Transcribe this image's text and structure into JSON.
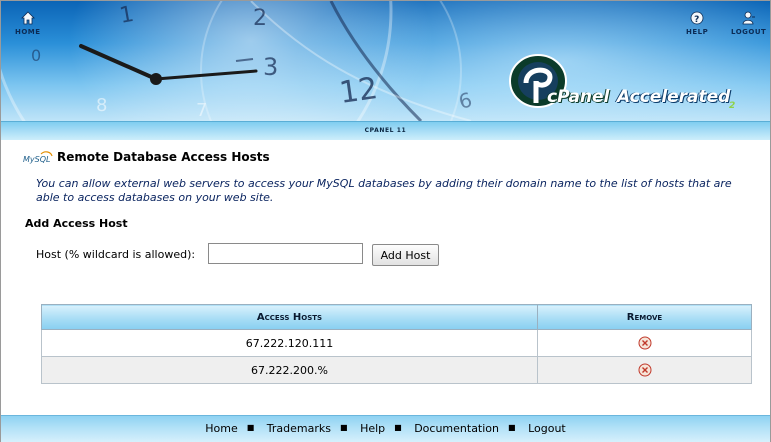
{
  "header": {
    "home_label": "HOME",
    "help_label": "HELP",
    "logout_label": "LOGOUT",
    "logo_word1": "cPanel",
    "logo_word2": "Accelerated",
    "logo_version": "2",
    "clock_numerals": [
      "2",
      "12",
      "3"
    ]
  },
  "version_bar": {
    "text": "CPANEL 11"
  },
  "page": {
    "mysql_logo_text": "MySQL",
    "title": "Remote Database Access Hosts",
    "description": "You can allow external web servers to access your MySQL databases by adding their domain name to the list of hosts that are able to access databases on your web site."
  },
  "add_host": {
    "section_title": "Add Access Host",
    "host_label": "Host (% wildcard is allowed):",
    "host_value": "",
    "button_label": "Add Host"
  },
  "table": {
    "columns": [
      "Access Hosts",
      "Remove"
    ],
    "rows": [
      {
        "host": "67.222.120.111"
      },
      {
        "host": "67.222.200.%"
      }
    ]
  },
  "footer": {
    "links": [
      "Home",
      "Trademarks",
      "Help",
      "Documentation",
      "Logout"
    ],
    "separator": "■"
  },
  "colors": {
    "banner_blue": "#2a8fd8",
    "bar_blue": "#a8ddf6",
    "remove_red": "#d9432f",
    "description_text": "#0b2560"
  },
  "icons": {
    "home": "home-icon",
    "help": "help-icon",
    "logout": "logout-icon",
    "remove": "remove-icon"
  }
}
